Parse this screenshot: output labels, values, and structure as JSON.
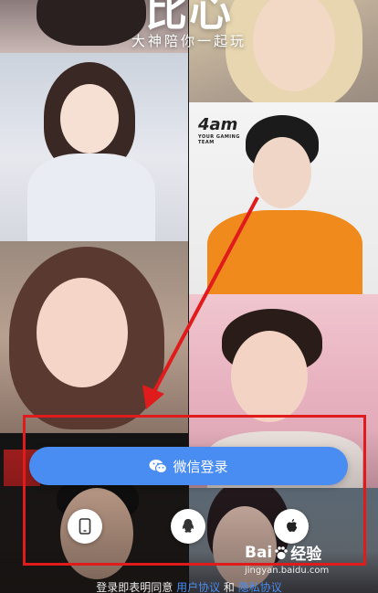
{
  "app": {
    "logo_text": "比心",
    "slogan": "大神陪你一起玩"
  },
  "tiles": {
    "team_logo_text": "4am",
    "team_logo_sub": "YOUR GAMING TEAM"
  },
  "login": {
    "wechat_label": "微信登录",
    "phone_icon": "phone-icon",
    "qq_icon": "qq-icon",
    "apple_icon": "apple-icon"
  },
  "agreement": {
    "prefix": "登录即表明同意",
    "user_agreement": "用户协议",
    "and": "和",
    "privacy_policy": "隐私协议"
  },
  "watermark": {
    "brand": "Bai",
    "brand_suffix": "经验",
    "url": "jingyan.baidu.com"
  },
  "colors": {
    "accent": "#4a8df2",
    "highlight": "#e01b1b"
  }
}
